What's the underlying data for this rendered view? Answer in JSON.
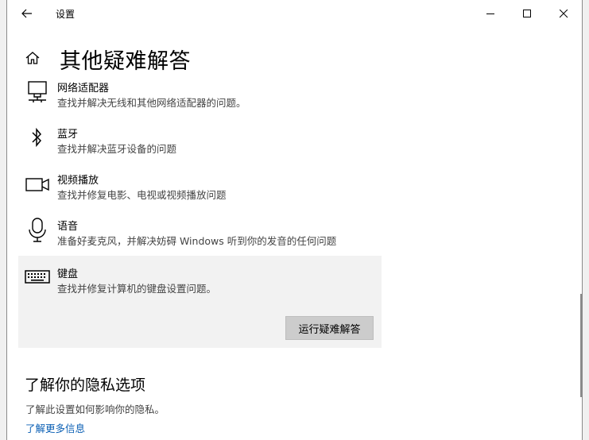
{
  "window": {
    "title": "设置"
  },
  "page": {
    "title": "其他疑难解答"
  },
  "items": [
    {
      "name": "网络适配器",
      "desc": "查找并解决无线和其他网络适配器的问题。",
      "icon": "network-adapter-icon"
    },
    {
      "name": "蓝牙",
      "desc": "查找并解决蓝牙设备的问题",
      "icon": "bluetooth-icon"
    },
    {
      "name": "视频播放",
      "desc": "查找并修复电影、电视或视频播放问题",
      "icon": "video-camera-icon"
    },
    {
      "name": "语音",
      "desc": "准备好麦克风，并解决妨碍 Windows 听到你的发音的任何问题",
      "icon": "microphone-icon"
    },
    {
      "name": "键盘",
      "desc": "查找并修复计算机的键盘设置问题。",
      "icon": "keyboard-icon"
    }
  ],
  "run_button": {
    "label": "运行疑难解答"
  },
  "privacy": {
    "title": "了解你的隐私选项",
    "desc": "了解此设置如何影响你的隐私。",
    "link": "了解更多信息"
  },
  "colors": {
    "link": "#0a5fb4",
    "selected_bg": "#f2f2f2",
    "button_bg": "#cccccc"
  }
}
